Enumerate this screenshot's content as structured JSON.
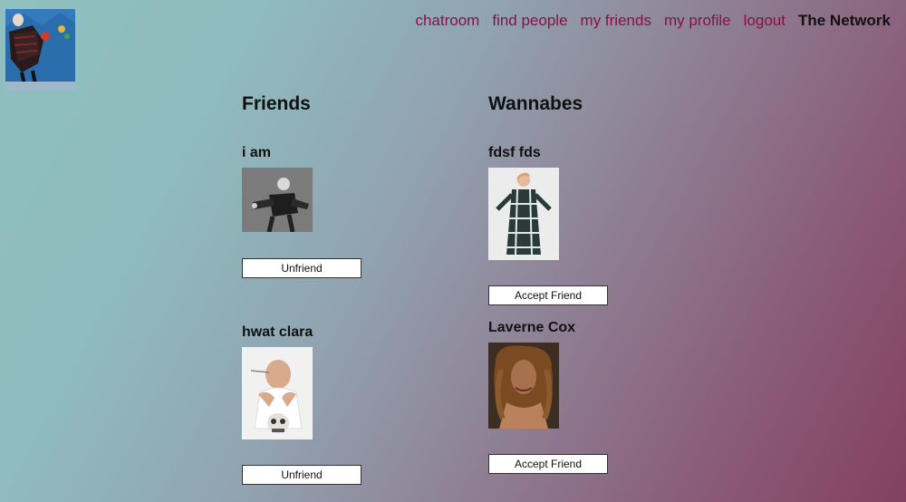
{
  "nav": {
    "items": [
      "chatroom",
      "find people",
      "my friends",
      "my profile",
      "logout"
    ],
    "brand": "The Network"
  },
  "friends": {
    "title": "Friends",
    "people": [
      {
        "name": "i am",
        "button": "Unfriend"
      },
      {
        "name": "hwat clara",
        "button": "Unfriend"
      }
    ]
  },
  "wannabes": {
    "title": "Wannabes",
    "people": [
      {
        "name": "fdsf fds",
        "button": "Accept Friend"
      },
      {
        "name": "Laverne Cox",
        "button": "Accept Friend"
      }
    ]
  },
  "colors": {
    "nav_link": "#8b0f45",
    "gradient_start": "#8fbfbf",
    "gradient_end": "#84405f"
  }
}
